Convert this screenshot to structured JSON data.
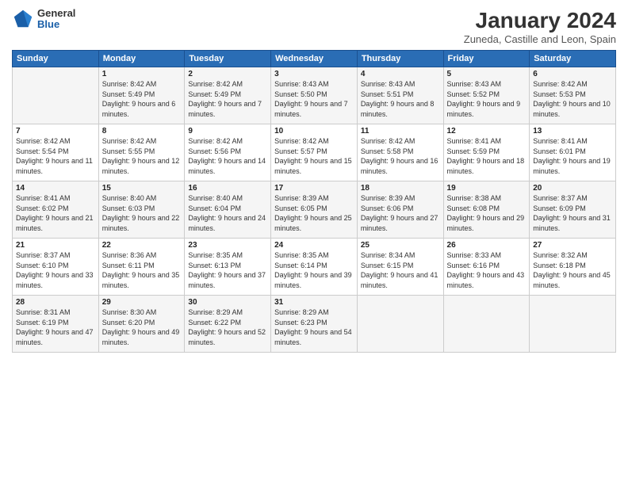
{
  "header": {
    "logo": {
      "general": "General",
      "blue": "Blue"
    },
    "title": "January 2024",
    "location": "Zuneda, Castille and Leon, Spain"
  },
  "calendar": {
    "weekdays": [
      "Sunday",
      "Monday",
      "Tuesday",
      "Wednesday",
      "Thursday",
      "Friday",
      "Saturday"
    ],
    "weeks": [
      [
        {
          "day": "",
          "sunrise": "",
          "sunset": "",
          "daylight": ""
        },
        {
          "day": "1",
          "sunrise": "Sunrise: 8:42 AM",
          "sunset": "Sunset: 5:49 PM",
          "daylight": "Daylight: 9 hours and 6 minutes."
        },
        {
          "day": "2",
          "sunrise": "Sunrise: 8:42 AM",
          "sunset": "Sunset: 5:49 PM",
          "daylight": "Daylight: 9 hours and 7 minutes."
        },
        {
          "day": "3",
          "sunrise": "Sunrise: 8:43 AM",
          "sunset": "Sunset: 5:50 PM",
          "daylight": "Daylight: 9 hours and 7 minutes."
        },
        {
          "day": "4",
          "sunrise": "Sunrise: 8:43 AM",
          "sunset": "Sunset: 5:51 PM",
          "daylight": "Daylight: 9 hours and 8 minutes."
        },
        {
          "day": "5",
          "sunrise": "Sunrise: 8:43 AM",
          "sunset": "Sunset: 5:52 PM",
          "daylight": "Daylight: 9 hours and 9 minutes."
        },
        {
          "day": "6",
          "sunrise": "Sunrise: 8:42 AM",
          "sunset": "Sunset: 5:53 PM",
          "daylight": "Daylight: 9 hours and 10 minutes."
        }
      ],
      [
        {
          "day": "7",
          "sunrise": "Sunrise: 8:42 AM",
          "sunset": "Sunset: 5:54 PM",
          "daylight": "Daylight: 9 hours and 11 minutes."
        },
        {
          "day": "8",
          "sunrise": "Sunrise: 8:42 AM",
          "sunset": "Sunset: 5:55 PM",
          "daylight": "Daylight: 9 hours and 12 minutes."
        },
        {
          "day": "9",
          "sunrise": "Sunrise: 8:42 AM",
          "sunset": "Sunset: 5:56 PM",
          "daylight": "Daylight: 9 hours and 14 minutes."
        },
        {
          "day": "10",
          "sunrise": "Sunrise: 8:42 AM",
          "sunset": "Sunset: 5:57 PM",
          "daylight": "Daylight: 9 hours and 15 minutes."
        },
        {
          "day": "11",
          "sunrise": "Sunrise: 8:42 AM",
          "sunset": "Sunset: 5:58 PM",
          "daylight": "Daylight: 9 hours and 16 minutes."
        },
        {
          "day": "12",
          "sunrise": "Sunrise: 8:41 AM",
          "sunset": "Sunset: 5:59 PM",
          "daylight": "Daylight: 9 hours and 18 minutes."
        },
        {
          "day": "13",
          "sunrise": "Sunrise: 8:41 AM",
          "sunset": "Sunset: 6:01 PM",
          "daylight": "Daylight: 9 hours and 19 minutes."
        }
      ],
      [
        {
          "day": "14",
          "sunrise": "Sunrise: 8:41 AM",
          "sunset": "Sunset: 6:02 PM",
          "daylight": "Daylight: 9 hours and 21 minutes."
        },
        {
          "day": "15",
          "sunrise": "Sunrise: 8:40 AM",
          "sunset": "Sunset: 6:03 PM",
          "daylight": "Daylight: 9 hours and 22 minutes."
        },
        {
          "day": "16",
          "sunrise": "Sunrise: 8:40 AM",
          "sunset": "Sunset: 6:04 PM",
          "daylight": "Daylight: 9 hours and 24 minutes."
        },
        {
          "day": "17",
          "sunrise": "Sunrise: 8:39 AM",
          "sunset": "Sunset: 6:05 PM",
          "daylight": "Daylight: 9 hours and 25 minutes."
        },
        {
          "day": "18",
          "sunrise": "Sunrise: 8:39 AM",
          "sunset": "Sunset: 6:06 PM",
          "daylight": "Daylight: 9 hours and 27 minutes."
        },
        {
          "day": "19",
          "sunrise": "Sunrise: 8:38 AM",
          "sunset": "Sunset: 6:08 PM",
          "daylight": "Daylight: 9 hours and 29 minutes."
        },
        {
          "day": "20",
          "sunrise": "Sunrise: 8:37 AM",
          "sunset": "Sunset: 6:09 PM",
          "daylight": "Daylight: 9 hours and 31 minutes."
        }
      ],
      [
        {
          "day": "21",
          "sunrise": "Sunrise: 8:37 AM",
          "sunset": "Sunset: 6:10 PM",
          "daylight": "Daylight: 9 hours and 33 minutes."
        },
        {
          "day": "22",
          "sunrise": "Sunrise: 8:36 AM",
          "sunset": "Sunset: 6:11 PM",
          "daylight": "Daylight: 9 hours and 35 minutes."
        },
        {
          "day": "23",
          "sunrise": "Sunrise: 8:35 AM",
          "sunset": "Sunset: 6:13 PM",
          "daylight": "Daylight: 9 hours and 37 minutes."
        },
        {
          "day": "24",
          "sunrise": "Sunrise: 8:35 AM",
          "sunset": "Sunset: 6:14 PM",
          "daylight": "Daylight: 9 hours and 39 minutes."
        },
        {
          "day": "25",
          "sunrise": "Sunrise: 8:34 AM",
          "sunset": "Sunset: 6:15 PM",
          "daylight": "Daylight: 9 hours and 41 minutes."
        },
        {
          "day": "26",
          "sunrise": "Sunrise: 8:33 AM",
          "sunset": "Sunset: 6:16 PM",
          "daylight": "Daylight: 9 hours and 43 minutes."
        },
        {
          "day": "27",
          "sunrise": "Sunrise: 8:32 AM",
          "sunset": "Sunset: 6:18 PM",
          "daylight": "Daylight: 9 hours and 45 minutes."
        }
      ],
      [
        {
          "day": "28",
          "sunrise": "Sunrise: 8:31 AM",
          "sunset": "Sunset: 6:19 PM",
          "daylight": "Daylight: 9 hours and 47 minutes."
        },
        {
          "day": "29",
          "sunrise": "Sunrise: 8:30 AM",
          "sunset": "Sunset: 6:20 PM",
          "daylight": "Daylight: 9 hours and 49 minutes."
        },
        {
          "day": "30",
          "sunrise": "Sunrise: 8:29 AM",
          "sunset": "Sunset: 6:22 PM",
          "daylight": "Daylight: 9 hours and 52 minutes."
        },
        {
          "day": "31",
          "sunrise": "Sunrise: 8:29 AM",
          "sunset": "Sunset: 6:23 PM",
          "daylight": "Daylight: 9 hours and 54 minutes."
        },
        {
          "day": "",
          "sunrise": "",
          "sunset": "",
          "daylight": ""
        },
        {
          "day": "",
          "sunrise": "",
          "sunset": "",
          "daylight": ""
        },
        {
          "day": "",
          "sunrise": "",
          "sunset": "",
          "daylight": ""
        }
      ]
    ]
  }
}
